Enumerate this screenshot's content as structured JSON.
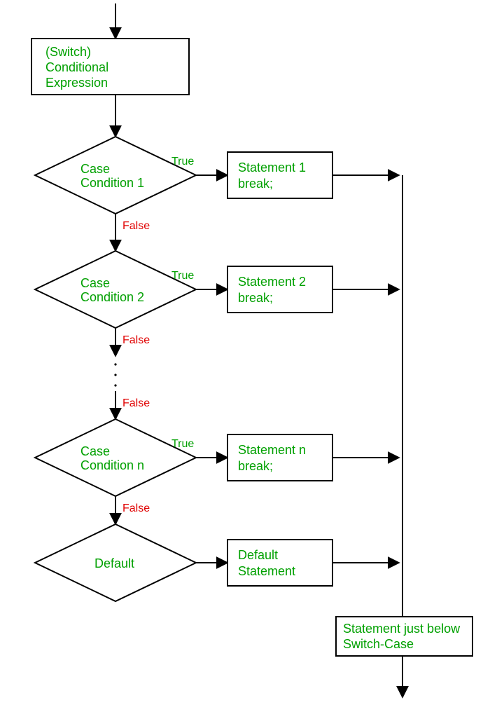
{
  "start": {
    "line1": "(Switch)",
    "line2": "Conditional",
    "line3": "Expression"
  },
  "cases": [
    {
      "cond1": "Case",
      "cond2": "Condition 1",
      "stmt1": "Statement 1",
      "stmt2": "break;"
    },
    {
      "cond1": "Case",
      "cond2": "Condition 2",
      "stmt1": "Statement 2",
      "stmt2": "break;"
    },
    {
      "cond1": "Case",
      "cond2": "Condition n",
      "stmt1": "Statement n",
      "stmt2": "break;"
    }
  ],
  "default": {
    "cond": "Default",
    "stmt1": "Default",
    "stmt2": "Statement"
  },
  "exit": {
    "line1": "Statement just below",
    "line2": "Switch-Case"
  },
  "labels": {
    "true": "True",
    "false": "False"
  }
}
